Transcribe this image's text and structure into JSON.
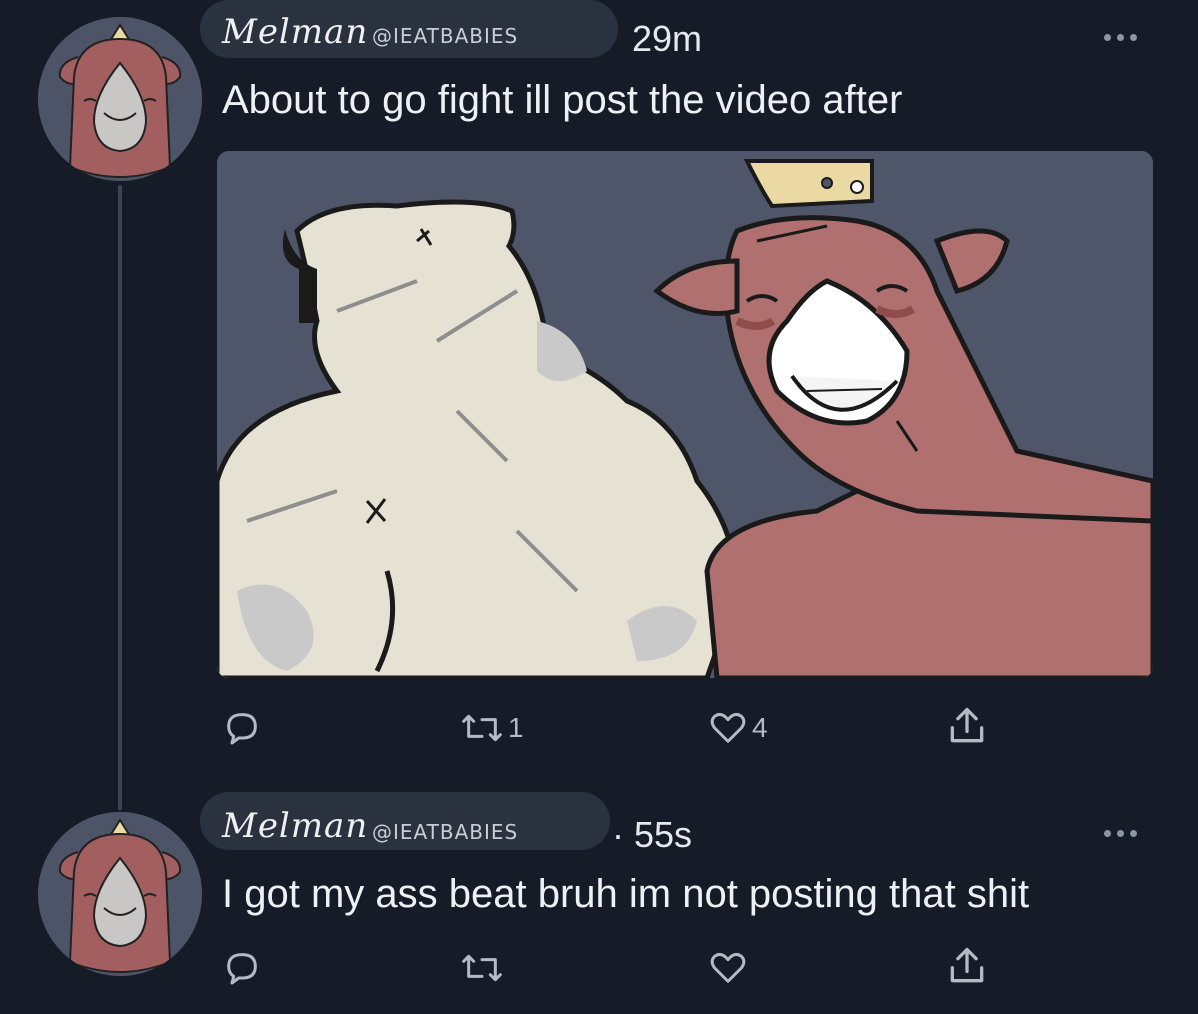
{
  "tweets": [
    {
      "display_name": "Melman",
      "handle": "@IEATBABIES",
      "time": "29m",
      "text": "About to go fight ill post the video after",
      "actions": {
        "reply_count": "",
        "retweet_count": "1",
        "like_count": "4"
      }
    },
    {
      "display_name": "Melman",
      "handle": "@IEATBABIES",
      "time": "· 55s",
      "text": "I got my ass beat bruh im not posting that shit",
      "actions": {
        "reply_count": "",
        "retweet_count": "",
        "like_count": ""
      }
    }
  ],
  "icons": {
    "reply": "reply-icon",
    "retweet": "retweet-icon",
    "like": "heart-icon",
    "share": "share-icon",
    "more": "more-icon"
  },
  "colors": {
    "background": "#151c27",
    "cow": "#b07070",
    "bear": "#e6e2d3",
    "media_bg": "#4f566a"
  }
}
